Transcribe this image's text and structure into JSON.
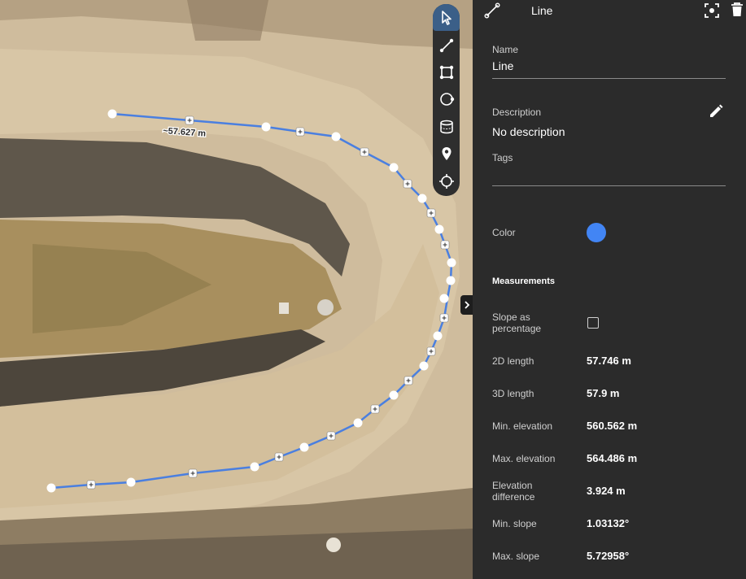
{
  "map": {
    "measure_label": "~57.627 m",
    "line_color": "#4a7fe0"
  },
  "toolbar": {
    "tools": [
      "pointer-icon",
      "line-icon",
      "polygon-icon",
      "circle-icon",
      "volume-icon",
      "marker-icon",
      "crosshair-icon"
    ],
    "active": "pointer-icon"
  },
  "panel": {
    "title": "Line",
    "name_label": "Name",
    "name_value": "Line",
    "description_label": "Description",
    "description_value": "No description",
    "tags_label": "Tags",
    "color_label": "Color",
    "color_value": "#4285f4",
    "measurements_title": "Measurements",
    "slope_percentage_label": "Slope as percentage",
    "measurements": [
      {
        "label": "2D length",
        "value": "57.746 m"
      },
      {
        "label": "3D length",
        "value": "57.9 m"
      },
      {
        "label": "Min. elevation",
        "value": "560.562 m"
      },
      {
        "label": "Max. elevation",
        "value": "564.486 m"
      },
      {
        "label": "Elevation difference",
        "value": "3.924 m"
      },
      {
        "label": "Min. slope",
        "value": "1.03132°"
      },
      {
        "label": "Max. slope",
        "value": "5.72958°"
      }
    ]
  }
}
